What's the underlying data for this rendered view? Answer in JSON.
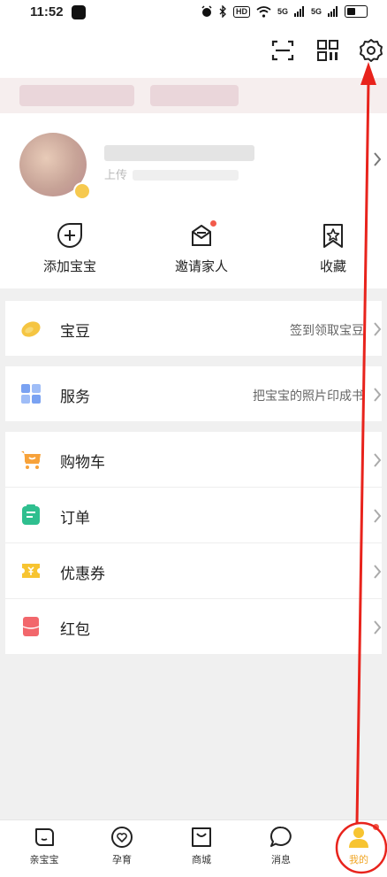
{
  "status_bar": {
    "time": "11:52",
    "hd_label": "HD",
    "signal1": "5G",
    "signal2": "5G"
  },
  "actions": [
    {
      "label": "添加宝宝",
      "icon": "add-baby-icon"
    },
    {
      "label": "邀请家人",
      "icon": "invite-mail-icon"
    },
    {
      "label": "收藏",
      "icon": "bookmark-star-icon"
    }
  ],
  "profile": {
    "upload_hint": "上传"
  },
  "baodou": {
    "title": "宝豆",
    "subtitle": "签到领取宝豆",
    "icon": "bean-icon"
  },
  "service": {
    "title": "服务",
    "subtitle": "把宝宝的照片印成书",
    "icon": "grid-icon"
  },
  "shop_items": [
    {
      "title": "购物车",
      "icon": "cart-icon"
    },
    {
      "title": "订单",
      "icon": "order-icon"
    },
    {
      "title": "优惠券",
      "icon": "coupon-icon"
    },
    {
      "title": "红包",
      "icon": "red-envelope-icon"
    }
  ],
  "bottom_nav": {
    "items": [
      {
        "label": "亲宝宝",
        "icon": "home-leaf-icon"
      },
      {
        "label": "孕育",
        "icon": "heart-circle-icon"
      },
      {
        "label": "商城",
        "icon": "shopping-bag-icon"
      },
      {
        "label": "消息",
        "icon": "chat-bubble-icon"
      },
      {
        "label": "我的",
        "icon": "person-icon",
        "active": true
      }
    ]
  },
  "colors": {
    "accent": "#f0a626",
    "annotation": "#e8231c",
    "badge": "#f25a4a"
  }
}
